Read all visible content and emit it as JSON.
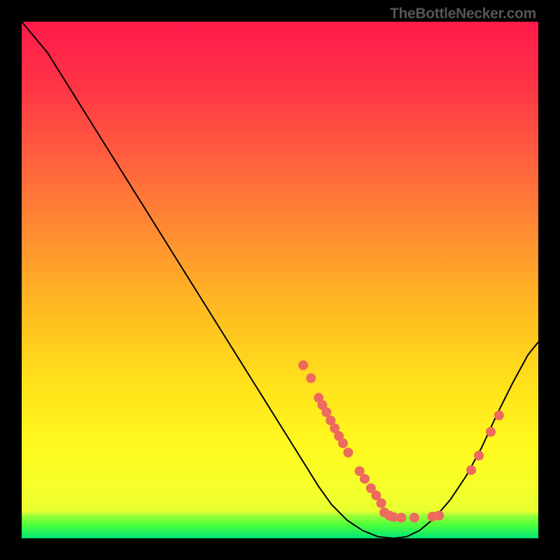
{
  "watermark": "TheBottleNecker.com",
  "chart_data": {
    "type": "line",
    "title": "",
    "xlabel": "",
    "ylabel": "",
    "xlim": [
      0,
      1
    ],
    "ylim": [
      0,
      1
    ],
    "grid": false,
    "series": [
      {
        "name": "main-curve",
        "stroke": "#000000",
        "x": [
          0.0,
          0.05,
          0.1,
          0.15,
          0.2,
          0.25,
          0.3,
          0.35,
          0.4,
          0.45,
          0.5,
          0.55,
          0.575,
          0.6,
          0.63,
          0.66,
          0.69,
          0.72,
          0.745,
          0.77,
          0.8,
          0.83,
          0.86,
          0.89,
          0.92,
          0.95,
          0.98,
          1.0
        ],
        "y": [
          1.0,
          0.94,
          0.86,
          0.78,
          0.7,
          0.62,
          0.54,
          0.46,
          0.38,
          0.3,
          0.22,
          0.14,
          0.1,
          0.065,
          0.035,
          0.015,
          0.003,
          0.0,
          0.003,
          0.015,
          0.04,
          0.075,
          0.12,
          0.175,
          0.24,
          0.3,
          0.355,
          0.38
        ]
      },
      {
        "name": "green-band",
        "type": "area",
        "fill_gradient": [
          "rgba(123,255,66,0)",
          "#5dff3a",
          "#2cff40",
          "#00e676"
        ],
        "y_top": 0.054,
        "y_bottom": 0.0
      }
    ],
    "scatter": {
      "name": "dots",
      "fill": "#ec6a5e",
      "r": 7,
      "points": [
        {
          "x": 0.545,
          "y": 0.335
        },
        {
          "x": 0.56,
          "y": 0.31
        },
        {
          "x": 0.575,
          "y": 0.272
        },
        {
          "x": 0.582,
          "y": 0.258
        },
        {
          "x": 0.59,
          "y": 0.244
        },
        {
          "x": 0.598,
          "y": 0.228
        },
        {
          "x": 0.606,
          "y": 0.213
        },
        {
          "x": 0.614,
          "y": 0.198
        },
        {
          "x": 0.622,
          "y": 0.184
        },
        {
          "x": 0.632,
          "y": 0.166
        },
        {
          "x": 0.654,
          "y": 0.13
        },
        {
          "x": 0.664,
          "y": 0.115
        },
        {
          "x": 0.676,
          "y": 0.097
        },
        {
          "x": 0.686,
          "y": 0.083
        },
        {
          "x": 0.696,
          "y": 0.068
        },
        {
          "x": 0.702,
          "y": 0.05
        },
        {
          "x": 0.712,
          "y": 0.044
        },
        {
          "x": 0.72,
          "y": 0.041
        },
        {
          "x": 0.735,
          "y": 0.04
        },
        {
          "x": 0.76,
          "y": 0.04
        },
        {
          "x": 0.795,
          "y": 0.042
        },
        {
          "x": 0.808,
          "y": 0.044
        },
        {
          "x": 0.87,
          "y": 0.132
        },
        {
          "x": 0.885,
          "y": 0.16
        },
        {
          "x": 0.908,
          "y": 0.206
        },
        {
          "x": 0.924,
          "y": 0.238
        }
      ]
    },
    "background_gradient": {
      "type": "linear-vertical",
      "stops": [
        {
          "offset": 0.0,
          "color": "#ff1a4b"
        },
        {
          "offset": 0.12,
          "color": "#ff3346"
        },
        {
          "offset": 0.25,
          "color": "#ff5b3f"
        },
        {
          "offset": 0.4,
          "color": "#ff8a33"
        },
        {
          "offset": 0.55,
          "color": "#ffb922"
        },
        {
          "offset": 0.7,
          "color": "#ffe11a"
        },
        {
          "offset": 0.82,
          "color": "#fff91f"
        },
        {
          "offset": 0.9,
          "color": "#f6ff2b"
        },
        {
          "offset": 0.945,
          "color": "#e9ff30"
        }
      ]
    }
  }
}
